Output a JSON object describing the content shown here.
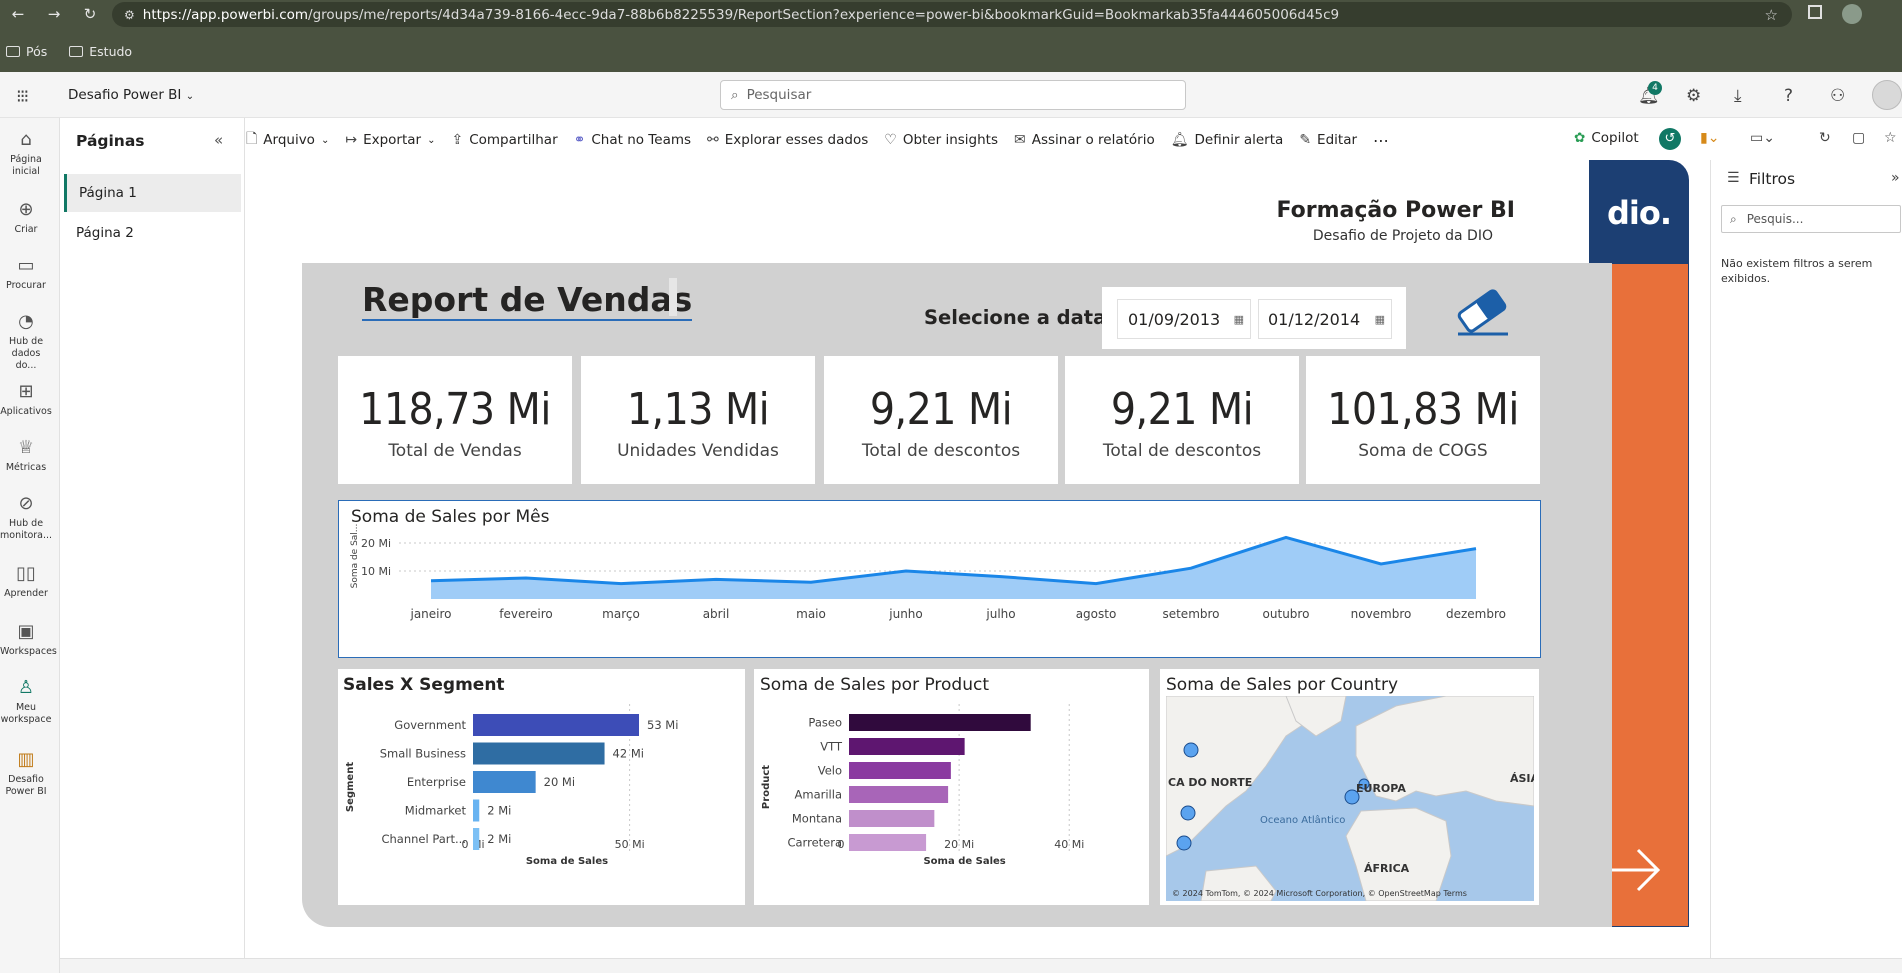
{
  "browser": {
    "url_host": "https://app.powerbi.com",
    "url_path": "/groups/me/reports/4d34a739-8166-4ecc-9da7-88b6b8225539/ReportSection?experience=power-bi&bookmarkGuid=Bookmarkab35fa444605006d45c9",
    "bookmarks": [
      "Pós",
      "Estudo"
    ]
  },
  "app": {
    "workspace_name": "Desafio Power BI",
    "search_placeholder": "Pesquisar",
    "notifications_count": "4"
  },
  "rail": {
    "items": [
      {
        "label": "Página inicial",
        "icon": "home-icon"
      },
      {
        "label": "Criar",
        "icon": "plus-circle-icon"
      },
      {
        "label": "Procurar",
        "icon": "folder-icon"
      },
      {
        "label": "Hub de dados do...",
        "icon": "data-hub-icon"
      },
      {
        "label": "Aplicativos",
        "icon": "apps-icon"
      },
      {
        "label": "Métricas",
        "icon": "trophy-icon"
      },
      {
        "label": "Hub de monitora...",
        "icon": "monitor-icon"
      },
      {
        "label": "Aprender",
        "icon": "book-icon"
      },
      {
        "label": "Workspaces",
        "icon": "workspaces-icon"
      },
      {
        "label": "Meu workspace",
        "icon": "person-icon"
      },
      {
        "label": "Desafio Power BI",
        "icon": "report-icon"
      }
    ]
  },
  "pages_panel": {
    "title": "Páginas",
    "pages": [
      "Página 1",
      "Página 2"
    ]
  },
  "toolbar": {
    "items": [
      "Arquivo",
      "Exportar",
      "Compartilhar",
      "Chat no Teams",
      "Explorar esses dados",
      "Obter insights",
      "Assinar o relatório",
      "Definir alerta",
      "Editar"
    ],
    "copilot": "Copilot"
  },
  "report": {
    "header_title": "Formação Power BI",
    "header_subtitle": "Desafio de Projeto da DIO",
    "title": "Report de Vendas",
    "date_label": "Selecione a data",
    "date_from": "01/09/2013",
    "date_to": "01/12/2014",
    "logo_text": "dio.",
    "cards": [
      {
        "value": "118,73 Mi",
        "label": "Total de Vendas"
      },
      {
        "value": "1,13 Mi",
        "label": "Unidades Vendidas"
      },
      {
        "value": "9,21 Mi",
        "label": "Total de descontos"
      },
      {
        "value": "9,21 Mi",
        "label": "Total de descontos"
      },
      {
        "value": "101,83 Mi",
        "label": "Soma de COGS"
      }
    ],
    "colors": {
      "accent_orange": "#e8703a",
      "dio_blue": "#1c3f73",
      "area_fill": "#9fccf7",
      "line": "#1a86e8"
    }
  },
  "filters": {
    "title": "Filtros",
    "search_placeholder": "Pesquis...",
    "empty_text": "Não existem filtros a serem exibidos."
  },
  "chart_data": [
    {
      "type": "area",
      "title": "Soma de Sales por Mês",
      "ylabel": "Soma de Sal...",
      "categories": [
        "janeiro",
        "fevereiro",
        "março",
        "abril",
        "maio",
        "junho",
        "julho",
        "agosto",
        "setembro",
        "outubro",
        "novembro",
        "dezembro"
      ],
      "values": [
        6.5,
        7.5,
        5.5,
        7,
        6,
        10,
        8,
        5.5,
        11,
        22,
        12.5,
        18
      ],
      "yticks": [
        "10 Mi",
        "20 Mi"
      ],
      "ylim": [
        0,
        25
      ]
    },
    {
      "type": "bar",
      "title": "Sales X Segment",
      "ylabel": "Segment",
      "xlabel": "Soma de Sales",
      "categories": [
        "Government",
        "Small Business",
        "Enterprise",
        "Midmarket",
        "Channel Part..."
      ],
      "values": [
        53,
        42,
        20,
        2,
        2
      ],
      "data_labels": [
        "53 Mi",
        "42 Mi",
        "20 Mi",
        "2 Mi",
        "2 Mi"
      ],
      "colors": [
        "#3d4db7",
        "#2f6da3",
        "#3f88d0",
        "#68b3f1",
        "#7cc0f5"
      ],
      "xticks": [
        "0 Mi",
        "50 Mi"
      ],
      "xlim": [
        0,
        60
      ]
    },
    {
      "type": "bar",
      "title": "Soma de Sales por Product",
      "ylabel": "Product",
      "xlabel": "Soma de Sales",
      "categories": [
        "Paseo",
        "VTT",
        "Velo",
        "Amarilla",
        "Montana",
        "Carretera"
      ],
      "values": [
        33,
        21,
        18.5,
        18,
        15.5,
        14
      ],
      "colors": [
        "#300a3d",
        "#5e1670",
        "#8a3aa0",
        "#a865b8",
        "#c08fcb",
        "#c89ad2"
      ],
      "xticks": [
        "0 Mi",
        "20 Mi",
        "40 Mi"
      ],
      "xlim": [
        0,
        42
      ]
    },
    {
      "type": "map",
      "title": "Soma de Sales por Country",
      "labels": [
        "CA DO NORTE",
        "EUROPA",
        "ÁSIA",
        "Oceano Atlântico",
        "ÁFRICA"
      ],
      "attribution": "© 2024 TomTom, © 2024 Microsoft Corporation, © OpenStreetMap  Terms"
    }
  ]
}
